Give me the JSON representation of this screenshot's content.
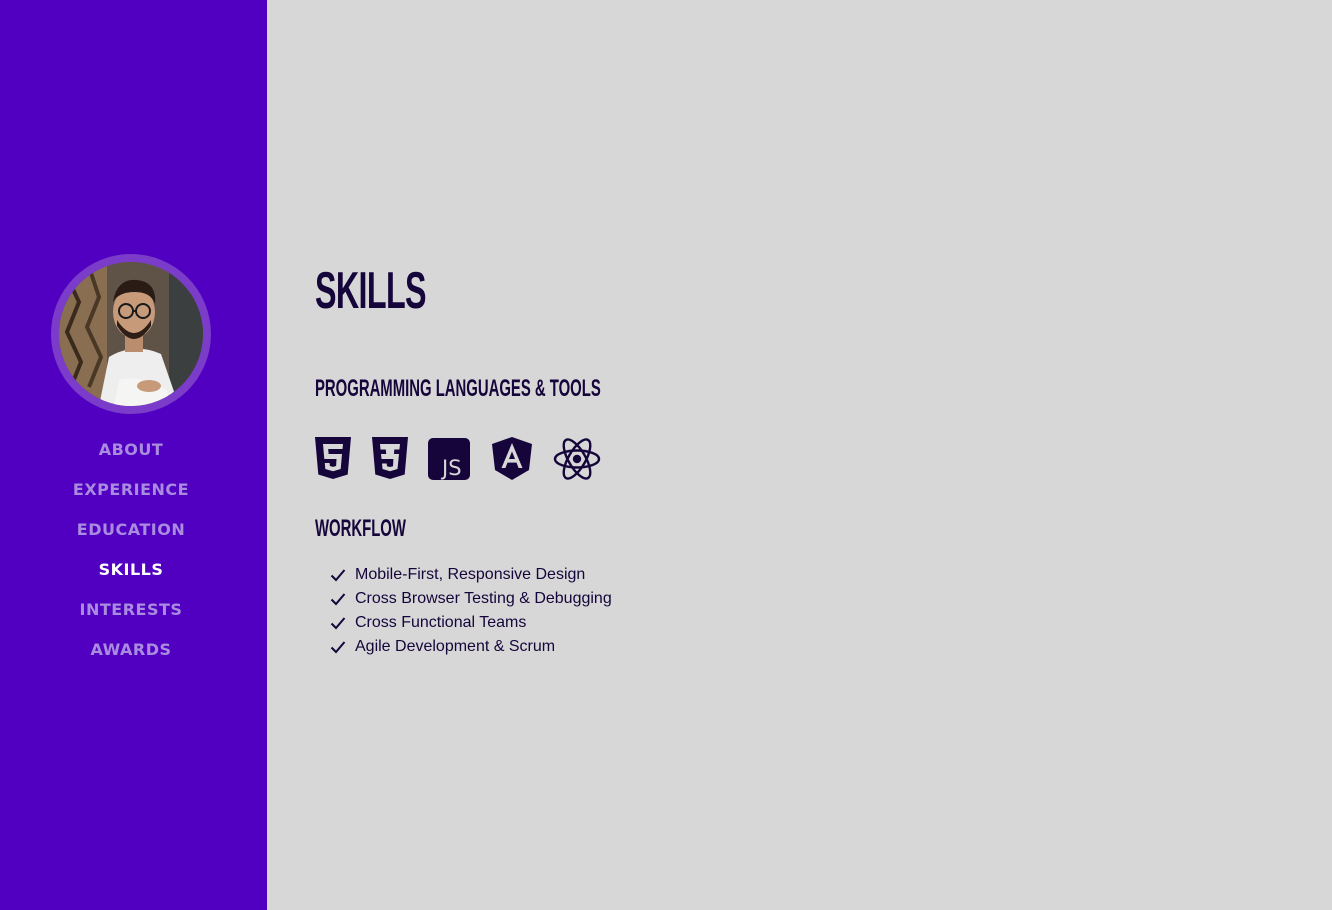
{
  "sidebar": {
    "background_color": "#5100c1",
    "avatar": {
      "alt": "profile-photo"
    },
    "nav": [
      {
        "label": "ABOUT",
        "active": false
      },
      {
        "label": "EXPERIENCE",
        "active": false
      },
      {
        "label": "EDUCATION",
        "active": false
      },
      {
        "label": "SKILLS",
        "active": true
      },
      {
        "label": "INTERESTS",
        "active": false
      },
      {
        "label": "AWARDS",
        "active": false
      }
    ]
  },
  "main": {
    "title": "SKILLS",
    "languages_heading": "PROGRAMMING LANGUAGES & TOOLS",
    "tool_icons": [
      "html5-icon",
      "css3-icon",
      "javascript-icon",
      "angular-icon",
      "react-icon"
    ],
    "workflow_heading": "WORKFLOW",
    "workflow_items": [
      "Mobile-First, Responsive Design",
      "Cross Browser Testing & Debugging",
      "Cross Functional Teams",
      "Agile Development & Scrum"
    ],
    "text_color": "#15053a",
    "background_color": "#d7d7d7"
  }
}
